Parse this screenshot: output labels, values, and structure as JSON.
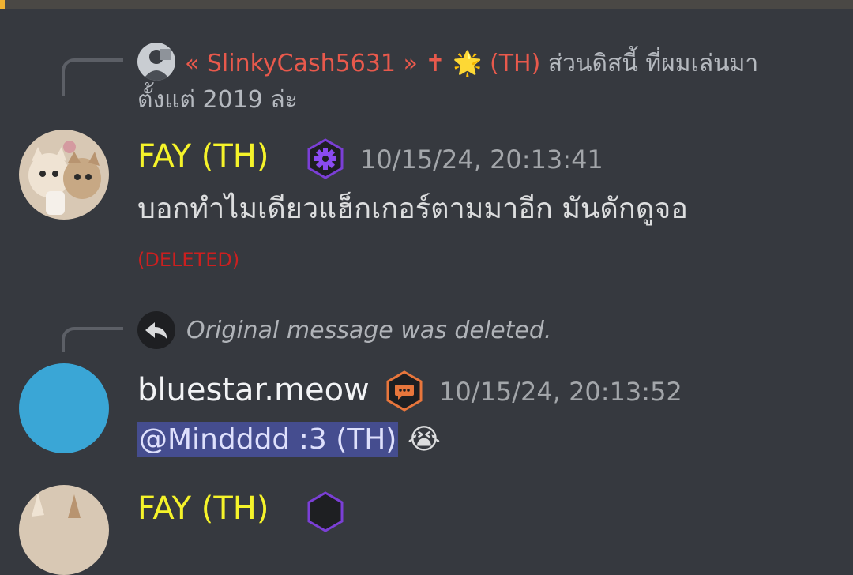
{
  "colors": {
    "background": "#36393f",
    "fay_name": "#f5f32a",
    "reply_name": "#e8594c",
    "deleted": "#cc1f1f",
    "mention_bg": "#5865f2"
  },
  "reply1": {
    "name": "« SlinkyCash5631 » ✝",
    "star": "🌟",
    "tag": "(TH)",
    "text": "ส่วนดิสนี้ ที่ผมเล่นมาตั้งแต่ 2019 ล่ะ"
  },
  "message1": {
    "author": "FAY (TH)",
    "badge_icon": "gear-hexagon-icon",
    "timestamp": "10/15/24, 20:13:41",
    "content": "บอกทำไมเดียวแฮ็กเกอร์ตามมาอีก มันดักดูจอ",
    "deleted_label": "(DELETED)"
  },
  "reply2": {
    "icon": "reply-arrow-icon",
    "text": "Original message was deleted."
  },
  "message2": {
    "author": "bluestar.meow",
    "badge_icon": "chat-hexagon-icon",
    "timestamp": "10/15/24, 20:13:52",
    "mention": "@Mindddd :3 (TH)",
    "emoji": "😭"
  },
  "message3": {
    "author": "FAY (TH)"
  }
}
